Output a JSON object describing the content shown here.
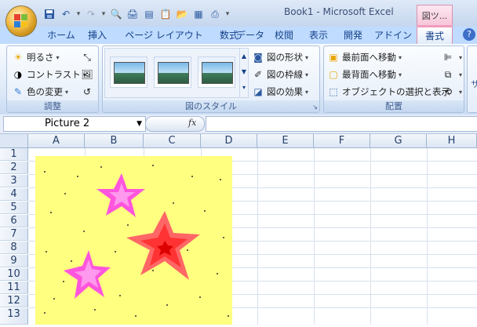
{
  "window": {
    "title": "Book1 - Microsoft Excel",
    "context_tab": "図ツ..."
  },
  "tabs": [
    {
      "label": "ホーム"
    },
    {
      "label": "挿入"
    },
    {
      "label": "ページ レイアウト"
    },
    {
      "label": "数式"
    },
    {
      "label": "データ"
    },
    {
      "label": "校閲"
    },
    {
      "label": "表示"
    },
    {
      "label": "開発"
    },
    {
      "label": "アドイン"
    },
    {
      "label": "書式",
      "active": true
    }
  ],
  "help_label": "?",
  "ribbon": {
    "adjust": {
      "label": "調整",
      "brightness": "明るさ",
      "contrast": "コントラスト",
      "recolor": "色の変更"
    },
    "styles": {
      "label": "図のスタイル",
      "shape": "図の形状",
      "border": "図の枠線",
      "effects": "図の効果"
    },
    "arrange": {
      "label": "配置",
      "bring_front": "最前面へ移動",
      "send_back": "最背面へ移動",
      "selection": "オブジェクトの選択と表示"
    },
    "size_label": "サ"
  },
  "formula_bar": {
    "name_box": "Picture 2",
    "fx": "fx",
    "formula": ""
  },
  "columns": [
    "A",
    "B",
    "C",
    "D",
    "E",
    "F",
    "G",
    "H"
  ],
  "rows": [
    "1",
    "2",
    "3",
    "4",
    "5",
    "6",
    "7",
    "8",
    "9",
    "10",
    "11",
    "12",
    "13"
  ],
  "colors": {
    "accent_tab": "#f09cbd",
    "picture_bg": "#ffff80",
    "star_pink": "#ff66dd",
    "star_red": "#ff3333"
  }
}
